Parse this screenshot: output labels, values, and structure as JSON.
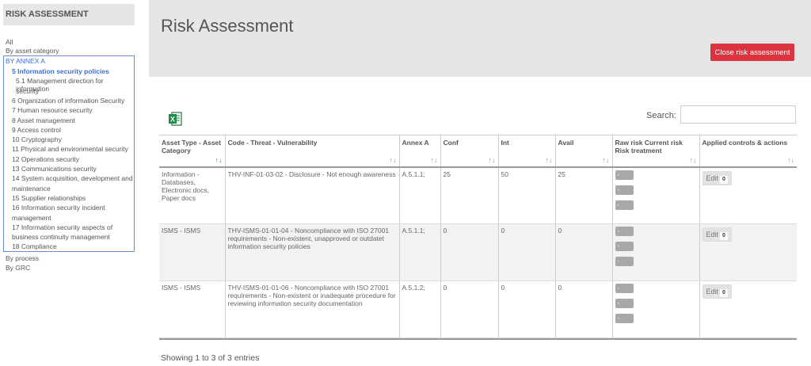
{
  "sidebar": {
    "title": "RISK ASSESSMENT",
    "top_items": [
      "All",
      "By asset category"
    ],
    "annex_title": "BY ANNEX A",
    "annex_items": [
      {
        "label": "5 Information security policies",
        "active": true
      },
      {
        "label": "5.1 Management direction for information",
        "sub": true
      },
      {
        "label": "security",
        "sub": true
      },
      {
        "label": "6 Organization of information Security"
      },
      {
        "label": "7 Human resource security"
      },
      {
        "label": "8 Asset management"
      },
      {
        "label": "9 Access control"
      },
      {
        "label": "10 Cryptography"
      },
      {
        "label": "11 Physical and environmental security"
      },
      {
        "label": "12 Operations security"
      },
      {
        "label": "13 Communications security"
      },
      {
        "label": "14 System acquisition, development and"
      },
      {
        "label": "maintenance"
      },
      {
        "label": "15 Supplier relationships"
      },
      {
        "label": "16 Information security incident"
      },
      {
        "label": "management"
      },
      {
        "label": "17 Information security aspects of"
      },
      {
        "label": "business continuity management"
      },
      {
        "label": "18 Compliance"
      }
    ],
    "bottom_items": [
      "By process",
      "By GRC"
    ]
  },
  "header": {
    "title": "Risk Assessment",
    "close_label": "Close risk assessment"
  },
  "search": {
    "label": "Search:",
    "value": ""
  },
  "table": {
    "headers": [
      "Asset Type - Asset Category",
      "Code - Threat - Vulnerability",
      "Annex A",
      "Conf",
      "Int",
      "Avail",
      "Raw risk Current risk Risk treatment",
      "Applied controls & actions"
    ],
    "rows": [
      {
        "asset": "Information - Databases, Electronic docs, Paper docs",
        "code": "THV-INF-01-03-02 - Disclosure - Not enough awareness",
        "annex": "A.5.1.1;",
        "conf": "25",
        "int": "50",
        "avail": "25",
        "risk_pills": [
          "-",
          "-",
          "-"
        ],
        "edit_label": "Edit",
        "edit_count": "0"
      },
      {
        "asset": "ISMS - ISMS",
        "code": "THV-ISMS-01-01-04 - Noncompliance with ISO 27001 requirements - Non-existent, unapproved or outdatet information security policies",
        "annex": "A.5.1.1;",
        "conf": "0",
        "int": "0",
        "avail": "0",
        "risk_pills": [
          "-",
          "-",
          "-"
        ],
        "edit_label": "Edit",
        "edit_count": "0"
      },
      {
        "asset": "ISMS - ISMS",
        "code": "THV-ISMS-01-01-06 - Noncompliance with ISO 27001 requirements - Non-existent or inadequate procedure for reviewing information security documentation",
        "annex": "A.5.1.2;",
        "conf": "0",
        "int": "0",
        "avail": "0",
        "risk_pills": [
          "-",
          "-",
          "-"
        ],
        "edit_label": "Edit",
        "edit_count": "0"
      }
    ],
    "footer": "Showing 1 to 3 of 3 entries"
  },
  "colors": {
    "accent": "#d9343f",
    "active_link": "#3b6fd6",
    "header_bg": "#e6e6e6"
  }
}
